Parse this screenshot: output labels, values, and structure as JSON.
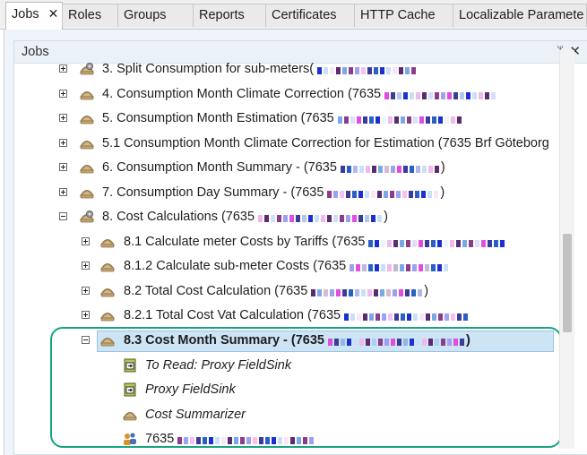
{
  "tabs": [
    {
      "label": "Jobs",
      "close": "✕",
      "active": true
    },
    {
      "label": "Roles"
    },
    {
      "label": "Groups"
    },
    {
      "label": "Reports"
    },
    {
      "label": "Certificates"
    },
    {
      "label": "HTTP Cache"
    },
    {
      "label": "Localizable Paramete"
    }
  ],
  "panel": {
    "title": "Jobs",
    "pin_glyph": "ᛘ",
    "close_glyph": "✕"
  },
  "tree": [
    {
      "label": "3. Split Consumption for sub-meters(",
      "icon": "gear-shell-icon",
      "toggle": "plus"
    },
    {
      "label": "4. Consumption Month Climate Correction (7635",
      "icon": "shell-icon",
      "toggle": "plus"
    },
    {
      "label": "5. Consumption Month Estimation (7635",
      "icon": "shell-icon",
      "toggle": "plus"
    },
    {
      "label": "5.1 Consumption Month Climate Correction for Estimation (7635 Brf Göteborg",
      "icon": "shell-icon",
      "toggle": "plus"
    },
    {
      "label": "6. Consumption Month Summary - (7635",
      "icon": "shell-icon",
      "toggle": "plus",
      "suffix": ")"
    },
    {
      "label": "7. Consumption Day Summary - (7635",
      "icon": "shell-icon",
      "toggle": "plus",
      "suffix": ")"
    },
    {
      "label": "8. Cost Calculations (7635",
      "icon": "gear-shell-icon",
      "toggle": "minus",
      "suffix": ")"
    },
    {
      "label": "8.1 Calculate meter Costs by Tariffs (7635",
      "icon": "shell-icon",
      "toggle": "plus"
    },
    {
      "label": "8.1.2 Calculate sub-meter Costs (7635",
      "icon": "shell-icon",
      "toggle": "plus"
    },
    {
      "label": "8.2 Total Cost Calculation (7635",
      "icon": "shell-icon",
      "toggle": "plus",
      "suffix": ")"
    },
    {
      "label": "8.2.1 Total Cost Vat Calculation (7635",
      "icon": "shell-icon",
      "toggle": "plus"
    },
    {
      "label": "8.3 Cost Month Summary - (7635",
      "icon": "shell-icon",
      "toggle": "minus",
      "selected": true,
      "suffix": ")"
    },
    {
      "label": "To Read: Proxy FieldSink",
      "icon": "proxy-sink-icon"
    },
    {
      "label": "Proxy FieldSink",
      "icon": "proxy-sink-icon"
    },
    {
      "label": "Cost Summarizer",
      "icon": "shell-icon"
    },
    {
      "label": "7635",
      "icon": "users-icon"
    }
  ],
  "colors": {
    "accent_box": "#18a383",
    "selection": "#cde4f5"
  }
}
